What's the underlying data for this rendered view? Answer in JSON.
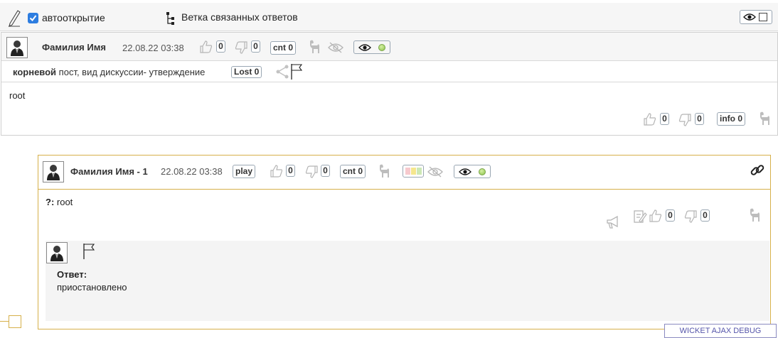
{
  "toolbar": {
    "autoopen_label": "автооткрытие",
    "autoopen_checked": true,
    "branch_label": "Ветка связанных ответов"
  },
  "post1": {
    "author": "Фамилия Имя",
    "date": "22.08.22 03:38",
    "likes": "0",
    "dislikes": "0",
    "cnt": "cnt 0",
    "meta_bold": "корневой",
    "meta_rest": " пост, вид дискуссии- утверждение",
    "lost": "Lost 0",
    "body": "root",
    "footer_likes": "0",
    "footer_dislikes": "0",
    "info": "info 0"
  },
  "post2": {
    "author": "Фамилия Имя - 1",
    "date": "22.08.22 03:38",
    "play": "play",
    "likes": "0",
    "dislikes": "0",
    "cnt": "cnt 0",
    "question_prefix": "?:",
    "question_text": " root",
    "inner_likes": "0",
    "inner_dislikes": "0",
    "answer_label": "Ответ:",
    "answer_text": "приостановлено"
  },
  "debug": {
    "label": "WICKET AJAX DEBUG"
  }
}
